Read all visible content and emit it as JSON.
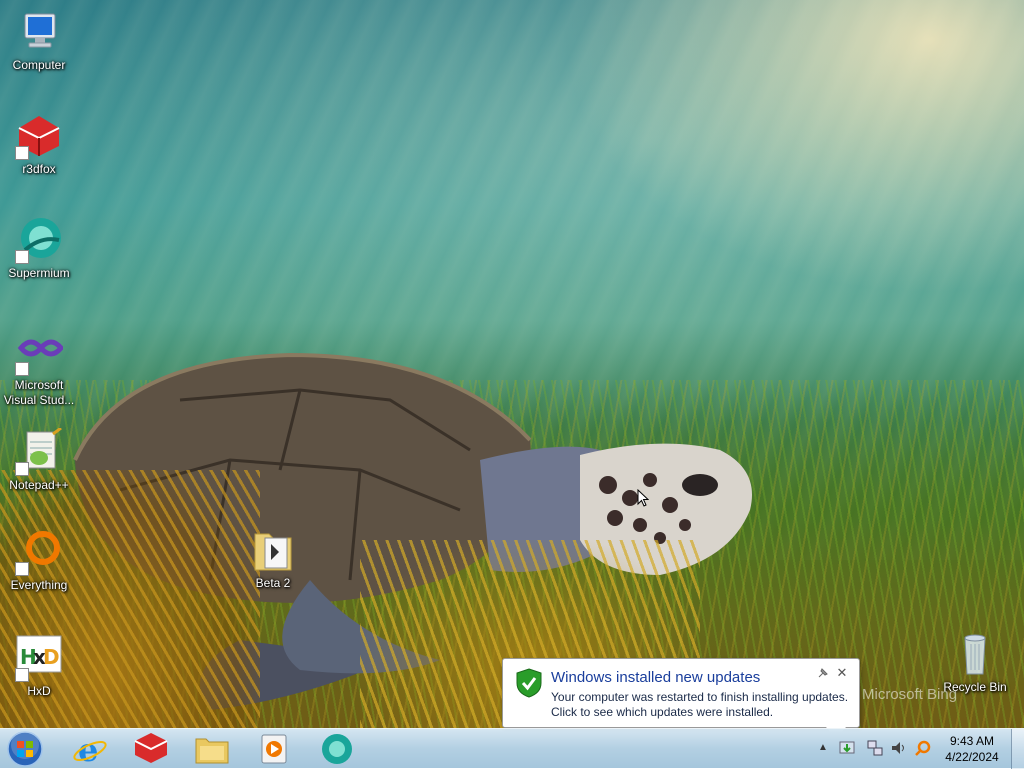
{
  "desktop": {
    "icons": [
      {
        "label": "Computer",
        "icon": "computer-icon"
      },
      {
        "label": "r3dfox",
        "icon": "r3dfox-icon"
      },
      {
        "label": "Supermium",
        "icon": "supermium-icon"
      },
      {
        "label": "Microsoft Visual Stud...",
        "icon": "visual-studio-icon"
      },
      {
        "label": "Notepad++",
        "icon": "notepadpp-icon"
      },
      {
        "label": "Everything",
        "icon": "everything-icon"
      },
      {
        "label": "HxD",
        "icon": "hxd-icon"
      },
      {
        "label": "Beta 2",
        "icon": "folder-icon"
      },
      {
        "label": "Recycle Bin",
        "icon": "recycle-bin-icon"
      }
    ],
    "watermark": "Microsoft Bing"
  },
  "taskbar": {
    "pinned": [
      "internet-explorer-icon",
      "r3dfox-icon",
      "file-explorer-icon",
      "media-player-icon",
      "supermium-icon"
    ],
    "clock": {
      "time": "9:43 AM",
      "date": "4/22/2024"
    }
  },
  "notification": {
    "title": "Windows installed new updates",
    "line1": "Your computer was restarted to finish installing updates.",
    "line2": "Click to see which updates were installed."
  },
  "colors": {
    "balloon_title": "#1a3e9c",
    "taskbar": "#afcde1",
    "shield_green": "#2a9d2a"
  }
}
